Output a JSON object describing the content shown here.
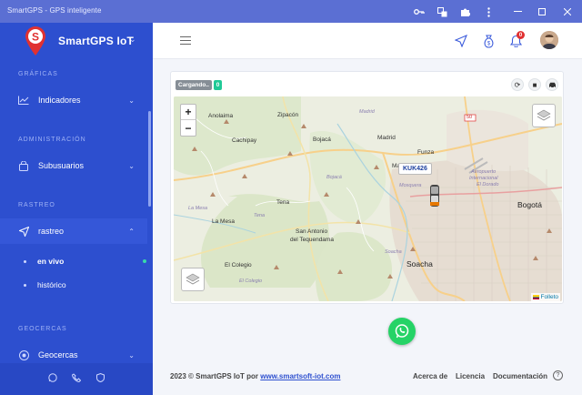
{
  "window": {
    "title": "SmartGPS - GPS inteligente",
    "icons": [
      "key-icon",
      "translate-icon",
      "puzzle-icon",
      "kebab-icon",
      "minimize-icon",
      "maximize-icon",
      "close-icon"
    ]
  },
  "sidebar": {
    "brand": "SmartGPS IoT",
    "sections": {
      "graficas": "GRÁFICAS",
      "administracion": "ADMINISTRACIÓN",
      "rastreo": "RASTREO",
      "geocercas": "GEOCERCAS"
    },
    "items": {
      "indicadores": "Indicadores",
      "subusuarios": "Subusuarios",
      "rastreo": "rastreo",
      "geocercas": "Geocercas"
    },
    "subitems": {
      "en_vivo": "en vivo",
      "historico": "histórico"
    },
    "colors": {
      "bg": "#2d4fcf",
      "active": "#3557d8",
      "accent": "#38d9a9"
    }
  },
  "topbar": {
    "notification_count": "0"
  },
  "tracking": {
    "status": "Cargando..",
    "vehicle_count": "0",
    "vehicle_label": "KUK426"
  },
  "map": {
    "places": {
      "anolaima": "Anolaima",
      "zipacon": "Zipacón",
      "cachipay": "Cachipay",
      "bojaca": "Bojacá",
      "madrid": "Madrid",
      "funza": "Funza",
      "mosquera": "Mosquera",
      "tena": "Tena",
      "la_mesa": "La Mesa",
      "san_antonio": "San Antonio",
      "tequendama": "del Tequendama",
      "el_colegio": "El Colegio",
      "soacha": "Soacha",
      "bogota": "Bogotá",
      "aeropuerto": "Aeropuerto",
      "internacional": "Internacional",
      "el_dorado": "El Dorado",
      "ma": "Ma"
    },
    "small_labels": {
      "madrid_it": "Madrid",
      "bojaca_it": "Bojacá",
      "la_mesa_it": "La Mesa",
      "tena_it": "Tena",
      "el_colegio_it": "El Colegio",
      "soacha_it": "Soacha"
    },
    "route_number": "50",
    "attribution": "Folleto"
  },
  "footer": {
    "copyright": "2023 © SmartGPS IoT por",
    "link": "www.smartsoft-iot.com",
    "about": "Acerca de",
    "license": "Licencia",
    "docs": "Documentación"
  }
}
